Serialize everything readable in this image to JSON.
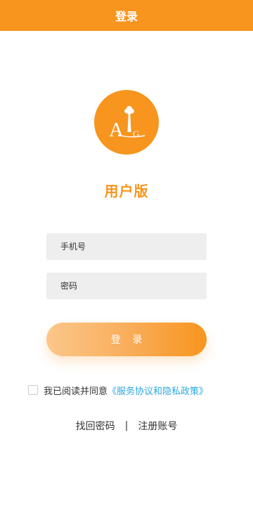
{
  "header": {
    "title": "登录"
  },
  "logo": {
    "letters": "AG",
    "letter_a": "A",
    "letter_g": "G"
  },
  "app_name": "用户版",
  "form": {
    "phone_placeholder": "手机号",
    "password_placeholder": "密码",
    "login_label": "登 录"
  },
  "agreement": {
    "text": "我已阅读并同意",
    "link": "《服务协议和隐私政策》",
    "checked": false
  },
  "links": {
    "forgot_password": "找回密码",
    "separator": "|",
    "register": "注册账号"
  },
  "colors": {
    "brand": "#F7951E",
    "link": "#29A8E0",
    "input_bg": "#EEEEEE"
  }
}
